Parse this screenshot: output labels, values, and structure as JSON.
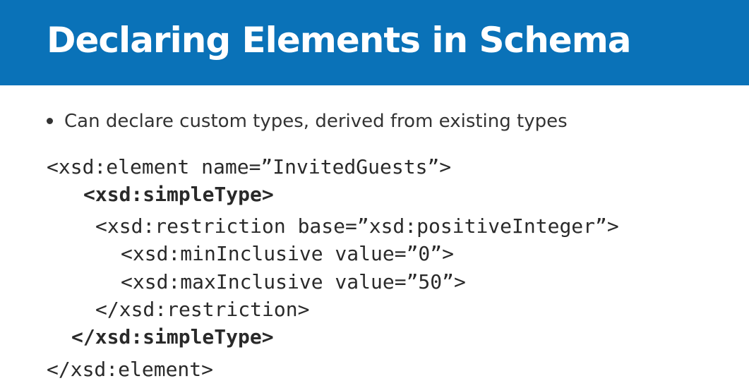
{
  "slide": {
    "title": "Declaring Elements in Schema",
    "bullets": [
      "Can declare custom types, derived from existing types"
    ],
    "code_lines": [
      "<xsd:element name=”InvitedGuests”>",
      "<xsd:simpleType>",
      "<xsd:restriction base=”xsd:positiveInteger”>",
      "<xsd:minInclusive value=”0”>",
      "<xsd:maxInclusive value=”50”>",
      "</xsd:restriction>",
      "</xsd:simpleType>",
      "</xsd:element>"
    ],
    "colors": {
      "title_bar": "#0a72b8",
      "title_text": "#ffffff",
      "body_text": "#2a2a2a"
    }
  }
}
